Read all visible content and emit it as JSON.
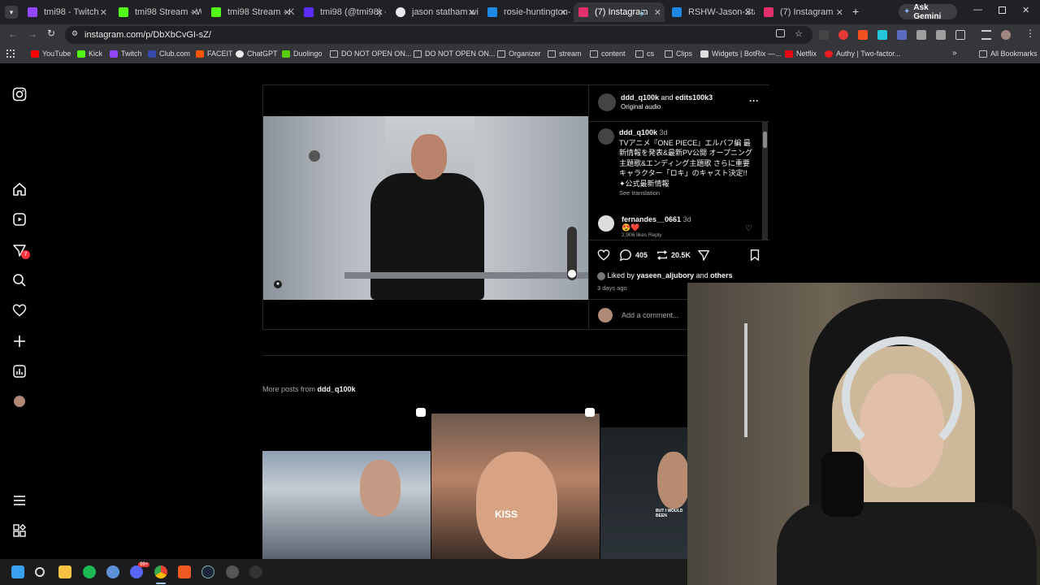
{
  "browser": {
    "tabs": [
      {
        "label": "tmi98 - Twitch",
        "color": "#9146ff"
      },
      {
        "label": "tmi98 Stream - W",
        "color": "#53fc18"
      },
      {
        "label": "tmi98 Stream - Ki",
        "color": "#53fc18"
      },
      {
        "label": "tmi98 (@tmi98) · T",
        "color": "#5b2bff"
      },
      {
        "label": "jason statham wife",
        "color": "#e8eaed"
      },
      {
        "label": "rosie-huntington-",
        "color": "#1e88e5"
      },
      {
        "label": "(7) Instagram",
        "color": "#e1306c"
      },
      {
        "label": "RSHW-Jason-Stath",
        "color": "#1e88e5"
      },
      {
        "label": "(7) Instagram",
        "color": "#e1306c"
      }
    ],
    "new_tab": "+",
    "gemini": "Ask Gemini",
    "url": "instagram.com/p/DbXbCvGI-sZ/",
    "bookmarks": [
      "YouTube",
      "Kick",
      "Twitch",
      "Club.com",
      "FACEIT",
      "ChatGPT",
      "Duolingo",
      "DO NOT OPEN ON...",
      "DO NOT OPEN ON...",
      "Organizer",
      "stream",
      "content",
      "cs",
      "Clips",
      "Widgets | BotRix —...",
      "Netflix",
      "Authy | Two-factor..."
    ],
    "all_bookmarks": "All Bookmarks"
  },
  "sidebar": {
    "icons": [
      "instagram-logo-icon",
      "home-icon",
      "reels-icon",
      "messages-icon",
      "search-icon",
      "heart-icon",
      "create-icon",
      "dashboard-icon",
      "profile-icon",
      "menu-icon",
      "threads-icon"
    ],
    "messages_badge": "7"
  },
  "post": {
    "header_user": "ddd_q100k",
    "header_and": "and",
    "header_collab": "edits100k3",
    "audio": "Original audio",
    "caption_user": "ddd_q100k",
    "caption_time": "3d",
    "caption_text": "TVアニメ『ONE PIECE』エルバフ編 最新情報を発表&最新PV公開 オープニング主題歌&エンディング主題歌 さらに重要キャラクター「ロキ」のキャスト決定!! ✦公式最新情報",
    "see_translation": "See translation",
    "comment_user": "fernandes__0661",
    "comment_time": "3d",
    "comment_text": "😍❤️",
    "comment_meta": "2,906 likes  Reply",
    "comment_count": "405",
    "repost_count": "20.5K",
    "liked_by_prefix": "Liked by",
    "liked_by_user": "yaseen_aljubory",
    "liked_by_suffix": "and",
    "liked_by_others": "others",
    "posted_ago": "3 days ago",
    "add_comment": "Add a comment..."
  },
  "more_posts": {
    "prefix": "More posts from",
    "user": "ddd_q100k",
    "thumb2_text": "KISS",
    "thumb3_text": "BUT I WOULD BEEN"
  },
  "taskbar": {
    "discord_badge": "99+"
  }
}
